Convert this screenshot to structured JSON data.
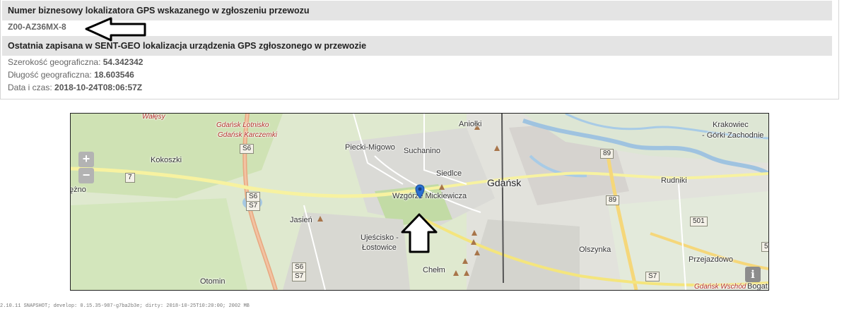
{
  "tracker_section": {
    "title": "Numer biznesowy lokalizatora GPS wskazanego w zgłoszeniu przewozu",
    "tracker_id": "Z00-AZ36MX-8"
  },
  "location_section": {
    "title": "Ostatnia zapisana w SENT-GEO lokalizacja urządzenia GPS zgłoszonego w przewozie",
    "latitude_label": "Szerokość geograficzna:",
    "latitude_value": "54.342342",
    "longitude_label": "Długość geograficzna:",
    "longitude_value": "18.603546",
    "datetime_label": "Data i czas:",
    "datetime_value": "2018-10-24T08:06:57Z"
  },
  "map": {
    "zoom_in": "+",
    "zoom_out": "−",
    "info": "i",
    "places": {
      "walesy": "Wałęsy",
      "gdansk_lotnisko": "Gdańsk Lotnisko",
      "gdansk_karczemki": "Gdańsk Karczemki",
      "kokoszki": "Kokoszki",
      "piecki": "Piecki-Migowo",
      "suchanino": "Suchanino",
      "aniolki": "Aniołki",
      "siedlce": "Siedlce",
      "gdansk": "Gdańsk",
      "wzgorze": "Wzgórze Mickiewicza",
      "krakowiec": "Krakowiec",
      "gorki": "- Górki Zachodnie",
      "rudniki": "Rudniki",
      "jasien": "Jasień",
      "ujescisko": "Ujeścisko -",
      "lostowice": "Łostowice",
      "chelm": "Chełm",
      "olszynka": "Olszynka",
      "przejazdowo": "Przejazdowo",
      "otomin": "Otomin",
      "gdansk_wschod": "Gdańsk Wschód",
      "bogat": "Bogat",
      "zno": "ężno"
    },
    "roads": {
      "s6_top": "S6",
      "r7": "7",
      "s6s7_mid_a": "S6",
      "s6s7_mid_b": "S7",
      "s6s7_low_a": "S6",
      "s6s7_low_b": "S7",
      "r89_top": "89",
      "r89_mid": "89",
      "r501": "501",
      "s7_right": "S7",
      "r5": "5"
    }
  },
  "footer": "2.10.11 SNAPSHOT; develop: 0.15.35-987-g7ba2b3e; dirty: 2018-10-25T10:20:00; 2002 MB"
}
